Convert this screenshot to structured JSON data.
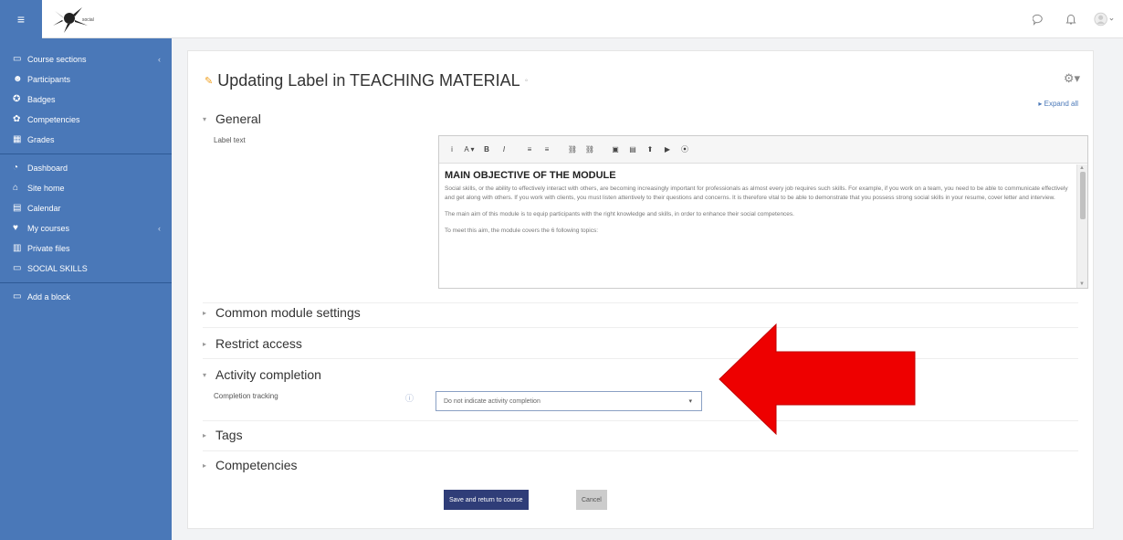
{
  "navbar": {
    "menu_icon": "hamburger-icon",
    "right_icons": [
      "chat-icon",
      "bell-icon",
      "user-avatar-icon"
    ]
  },
  "sidebar": {
    "items": [
      {
        "label": "Course sections",
        "icon": "folder-icon",
        "chev": "‹"
      },
      {
        "label": "Participants",
        "icon": "users-icon"
      },
      {
        "label": "Badges",
        "icon": "badge-icon"
      },
      {
        "label": "Competencies",
        "icon": "competency-icon"
      },
      {
        "label": "Grades",
        "icon": "grades-icon"
      }
    ],
    "items2": [
      {
        "label": "Dashboard",
        "icon": "dashboard-icon"
      },
      {
        "label": "Site home",
        "icon": "home-icon"
      },
      {
        "label": "Calendar",
        "icon": "calendar-icon"
      },
      {
        "label": "My courses",
        "icon": "courses-icon",
        "chev": "‹"
      },
      {
        "label": "Private files",
        "icon": "files-icon"
      },
      {
        "label": "SOCIAL SKILLS",
        "icon": "course-icon"
      }
    ],
    "items3": [
      {
        "label": "Add a block",
        "icon": "add-block-icon"
      }
    ]
  },
  "page": {
    "title": "Updating Label in TEACHING MATERIAL",
    "expand_all": "Expand all"
  },
  "sections": {
    "general": "General",
    "label_text": "Label text",
    "common": "Common module settings",
    "restrict": "Restrict access",
    "completion": "Activity completion",
    "completion_tracking": "Completion tracking",
    "tags": "Tags",
    "competencies": "Competencies"
  },
  "editor": {
    "toolbar": [
      "i",
      "A ▾",
      "B",
      "I",
      "≡",
      "≡",
      "⛓",
      "⛓",
      "▣",
      "▤",
      "⬆",
      "▶",
      "⦿"
    ],
    "heading": "MAIN OBJECTIVE OF THE MODULE",
    "para1": "Social skills, or the ability to effectively interact with others, are becoming increasingly important for professionals as almost every job requires such skills. For example, if you work on a team, you need to be able to communicate effectively and get along with others. If you work with clients, you must listen attentively to their questions and concerns. It is therefore vital to be able to demonstrate that you possess strong social skills in your resume, cover letter and interview.",
    "para2": "The main aim of this module is to equip participants with the right knowledge and skills, in order to enhance their social competences.",
    "para3": "To meet this aim, the module covers the 6 following topics:"
  },
  "completion": {
    "selected": "Do not indicate activity completion"
  },
  "buttons": {
    "save": "Save and return to course",
    "cancel": "Cancel"
  },
  "colors": {
    "sidebar": "#4a78b8",
    "primary_button": "#2f3d78",
    "arrow": "#ee0000"
  }
}
